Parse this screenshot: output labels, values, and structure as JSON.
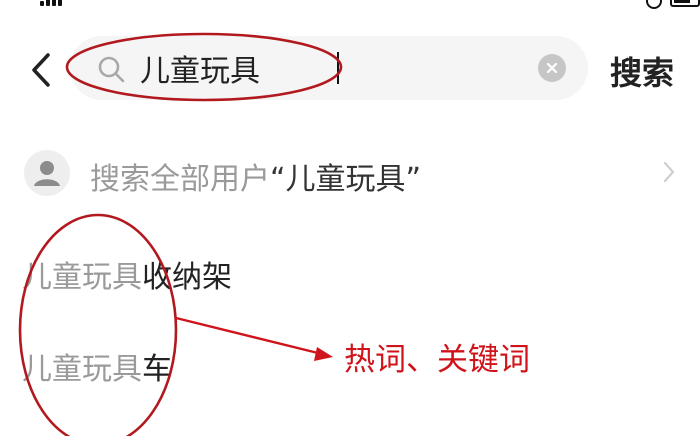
{
  "search": {
    "value": "儿童玩具",
    "submit_label": "搜索"
  },
  "user_search": {
    "label_prefix": "搜索全部用户",
    "label_keyword": "“儿童玩具”"
  },
  "suggestions": [
    {
      "highlight": "儿童玩具",
      "rest": "收纳架"
    },
    {
      "highlight": "儿童玩具",
      "rest": "车"
    }
  ],
  "annotation": {
    "text": "热词、关键词",
    "color": "#d0131a"
  },
  "icons": {
    "back": "chevron-left-icon",
    "search": "search-icon",
    "clear": "clear-icon",
    "user": "user-icon",
    "forward": "chevron-right-icon"
  }
}
